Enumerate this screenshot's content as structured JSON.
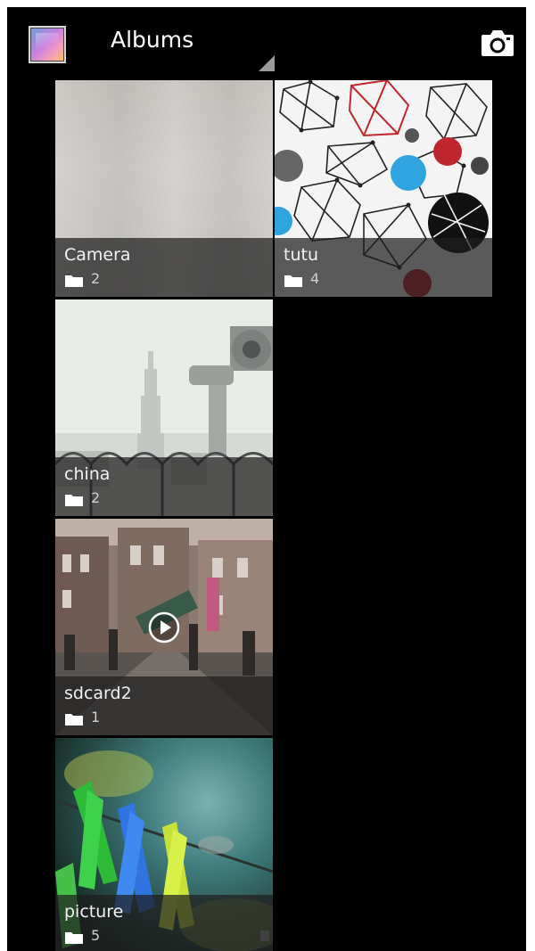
{
  "action_bar": {
    "spinner_label": "Albums",
    "app_icon": "gallery-app-icon",
    "action_icon": "camera-icon"
  },
  "albums": [
    {
      "name": "Camera",
      "count": "2",
      "icon": "folder-icon"
    },
    {
      "name": "tutu",
      "count": "4",
      "icon": "folder-icon"
    },
    {
      "name": "china",
      "count": "2",
      "icon": "folder-icon"
    },
    {
      "name": "sdcard2",
      "count": "1",
      "icon": "folder-icon",
      "has_video": true
    },
    {
      "name": "picture",
      "count": "5",
      "icon": "folder-icon"
    }
  ],
  "colors": {
    "background": "#000000",
    "caption_overlay": "#1e1e1e",
    "text": "#f2f2f2",
    "spinner_indicator": "#9a9a9a"
  }
}
